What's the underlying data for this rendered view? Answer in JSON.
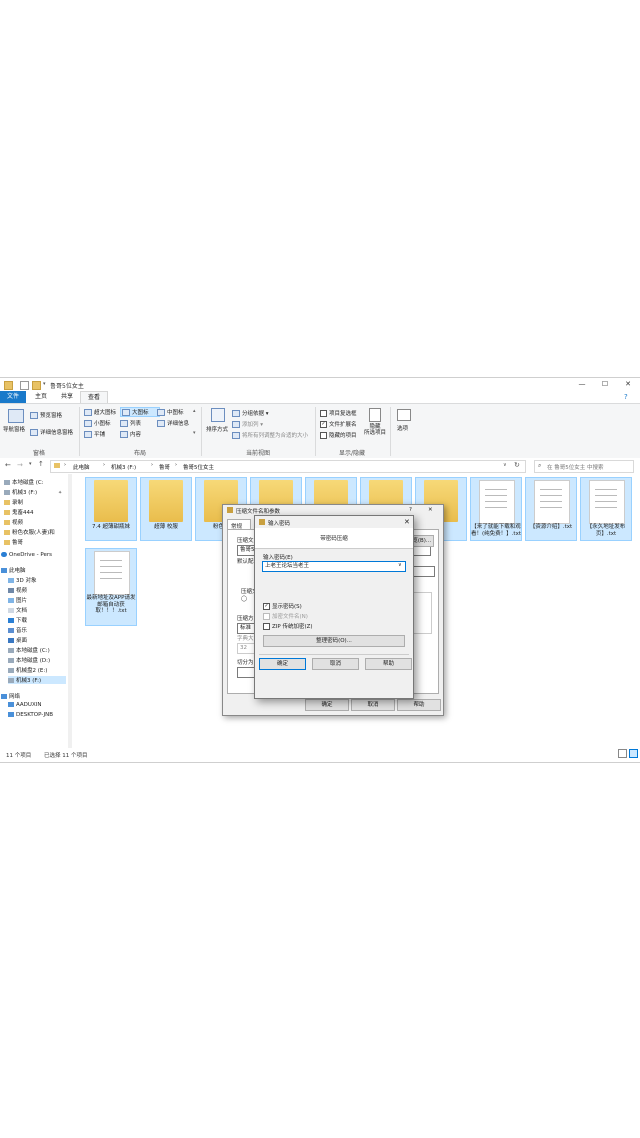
{
  "titlebar": {
    "title": "鲁哥5位女主",
    "minimize": "—",
    "maximize": "☐",
    "close": "✕"
  },
  "tabs": [
    "文件",
    "主页",
    "共享",
    "查看"
  ],
  "ribbon": {
    "pane": {
      "nav_pane": "导航窗格",
      "preview_pane": "预览窗格",
      "details_pane": "详细信息窗格",
      "group": "窗格"
    },
    "layout": {
      "extra_large": "超大图标",
      "large": "大图标",
      "medium": "中图标",
      "small": "小图标",
      "list": "列表",
      "details": "详细信息",
      "tiles": "平铺",
      "content": "内容",
      "group": "布局"
    },
    "current_view": {
      "sort_by": "排序方式",
      "group_by": "分组依据 ▾",
      "add_columns": "添加列 ▾",
      "size_all": "将所有列调整为合适的大小",
      "group": "当前视图"
    },
    "show_hide": {
      "item_checkboxes": "项目复选框",
      "file_ext": "文件扩展名",
      "hidden_items": "隐藏的项目",
      "hide_selected": "隐藏\n所选项目",
      "group": "显示/隐藏"
    },
    "options": "选项"
  },
  "address": {
    "breadcrumb": [
      "此电脑",
      "机械3 (F:)",
      "鲁哥",
      "鲁哥5位女主"
    ],
    "search_placeholder": "在 鲁哥5位女主 中搜索"
  },
  "nav": [
    {
      "label": "本地磁盘 (C:",
      "icon": "drive-icon"
    },
    {
      "label": "机械3 (F:)",
      "icon": "drive-icon"
    },
    {
      "label": "录制",
      "icon": "folder-icon"
    },
    {
      "label": "鬼畜444",
      "icon": "folder-icon"
    },
    {
      "label": "视频",
      "icon": "folder-icon"
    },
    {
      "label": "粉色衣服(人妻)和",
      "icon": "folder-icon"
    },
    {
      "label": "鲁哥",
      "icon": "folder-icon"
    },
    {
      "label": "OneDrive - Pers",
      "icon": "cloud-icon"
    },
    {
      "label": "此电脑",
      "icon": "computer-icon"
    },
    {
      "label": "3D 对象",
      "icon": "cube-icon"
    },
    {
      "label": "视频",
      "icon": "video-icon"
    },
    {
      "label": "图片",
      "icon": "picture-icon"
    },
    {
      "label": "文档",
      "icon": "document-icon"
    },
    {
      "label": "下载",
      "icon": "download-icon"
    },
    {
      "label": "音乐",
      "icon": "music-icon"
    },
    {
      "label": "桌面",
      "icon": "desktop-icon"
    },
    {
      "label": "本地磁盘 (C:)",
      "icon": "drive-icon"
    },
    {
      "label": "本地磁盘 (D:)",
      "icon": "drive-icon"
    },
    {
      "label": "机械盘2 (E:)",
      "icon": "drive-icon"
    },
    {
      "label": "机械3 (F:)",
      "icon": "drive-icon"
    },
    {
      "label": "网络",
      "icon": "network-icon"
    },
    {
      "label": "AADUXIN",
      "icon": "computer-icon"
    },
    {
      "label": "DESKTOP-JNB",
      "icon": "computer-icon"
    }
  ],
  "files": [
    {
      "label": "7.4 超薄甜瓶妹",
      "kind": "folder"
    },
    {
      "label": "超薄 校服",
      "kind": "folder"
    },
    {
      "label": "粉色...",
      "kind": "folder"
    },
    {
      "label": "",
      "kind": "folder"
    },
    {
      "label": "",
      "kind": "folder"
    },
    {
      "label": "",
      "kind": "folder"
    },
    {
      "label": "! !",
      "kind": "folder"
    },
    {
      "label": "【来了就能下载和观看！(纯免费！】.txt",
      "kind": "doc"
    },
    {
      "label": "【资源介绍】.txt",
      "kind": "doc"
    },
    {
      "label": "【永久地址发布页】.txt",
      "kind": "doc"
    },
    {
      "label": "最新地址及APP请发邮箱自动获取！！！.txt",
      "kind": "doc"
    }
  ],
  "status": {
    "count": "11 个项目",
    "selected": "已选择 11 个项目"
  },
  "archive_dialog": {
    "title": "压缩文件名和参数",
    "tab_general": "常规",
    "archive_name_label": "压缩文",
    "archive_name_value": "鲁哥5",
    "browse": "浏览(B)...",
    "default_label": "默认配",
    "format_label": "压缩文",
    "method_label": "压缩方",
    "method_value": "标准",
    "dict_label": "字典大",
    "dict_value": "32",
    "split_label": "切分为",
    "ok": "确定",
    "cancel": "取消",
    "help": "帮助"
  },
  "password_dialog": {
    "title": "输入密码",
    "subtitle": "带密码压缩",
    "label": "输入密码(E)",
    "value": "上老王论坛当老王",
    "show_password": "显示密码(S)",
    "encrypt_names": "加密文件名(N)",
    "zip_legacy": "ZIP 传统加密(Z)",
    "organize": "整理密码(O)...",
    "ok": "确定",
    "cancel": "取消",
    "help": "帮助",
    "help_glyph": "?",
    "close_glyph": "✕"
  }
}
